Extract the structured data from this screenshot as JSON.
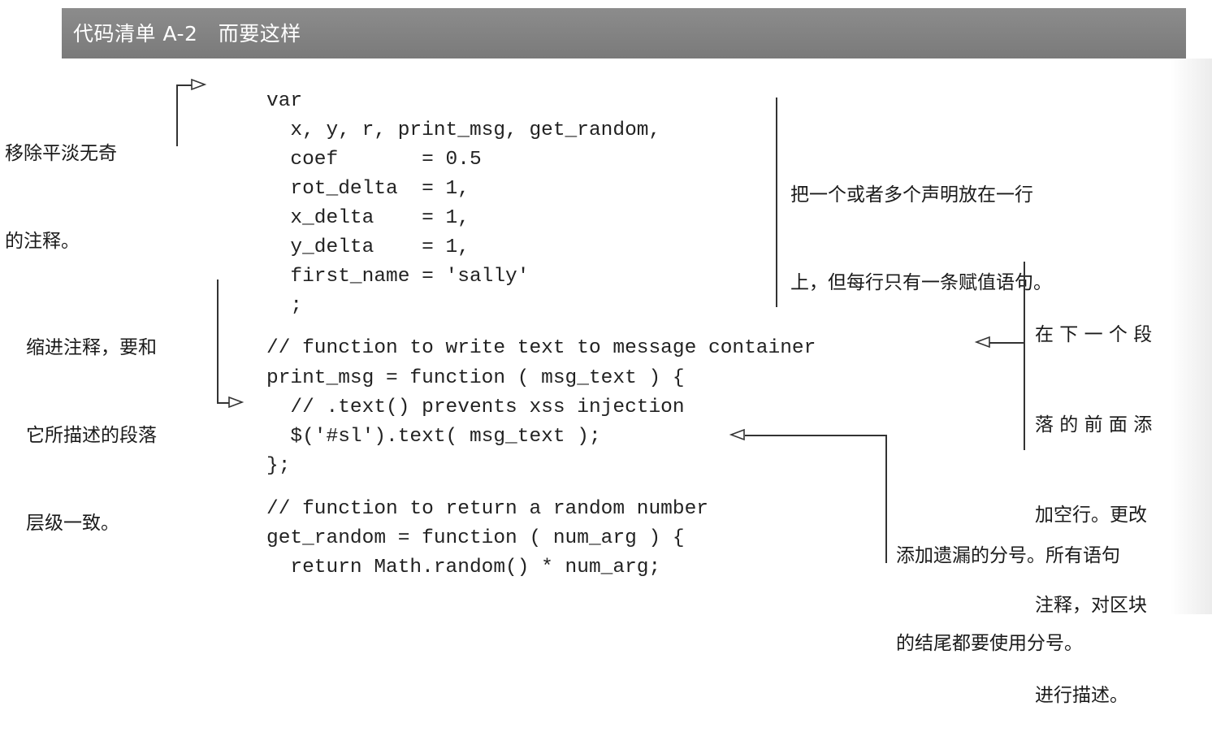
{
  "header": {
    "title": "代码清单 A-2   而要这样"
  },
  "code": {
    "lines": [
      "var",
      "  x, y, r, print_msg, get_random,",
      "  coef       = 0.5",
      "  rot_delta  = 1,",
      "  x_delta    = 1,",
      "  y_delta    = 1,",
      "  first_name = 'sally'",
      "  ;",
      "// function to write text to message container",
      "print_msg = function ( msg_text ) {",
      "  // .text() prevents xss injection",
      "  $('#sl').text( msg_text );",
      "};",
      "// function to return a random number",
      "get_random = function ( num_arg ) {",
      "  return Math.random() * num_arg;"
    ]
  },
  "annotations": {
    "remove_comments": {
      "lines": [
        "移除平淡无奇",
        "的注释。"
      ]
    },
    "declarations": {
      "lines": [
        "把一个或者多个声明放在一行",
        "上，但每行只有一条赋值语句。"
      ]
    },
    "indent_comments": {
      "lines": [
        "缩进注释，要和",
        "它所描述的段落",
        "层级一致。"
      ]
    },
    "blank_line": {
      "lines": [
        "在 下 一 个 段",
        "落 的 前 面 添",
        "加空行。更改",
        "注释，对区块",
        "进行描述。"
      ]
    },
    "semicolon": {
      "lines": [
        "添加遗漏的分号。所有语句",
        "的结尾都要使用分号。"
      ]
    }
  }
}
